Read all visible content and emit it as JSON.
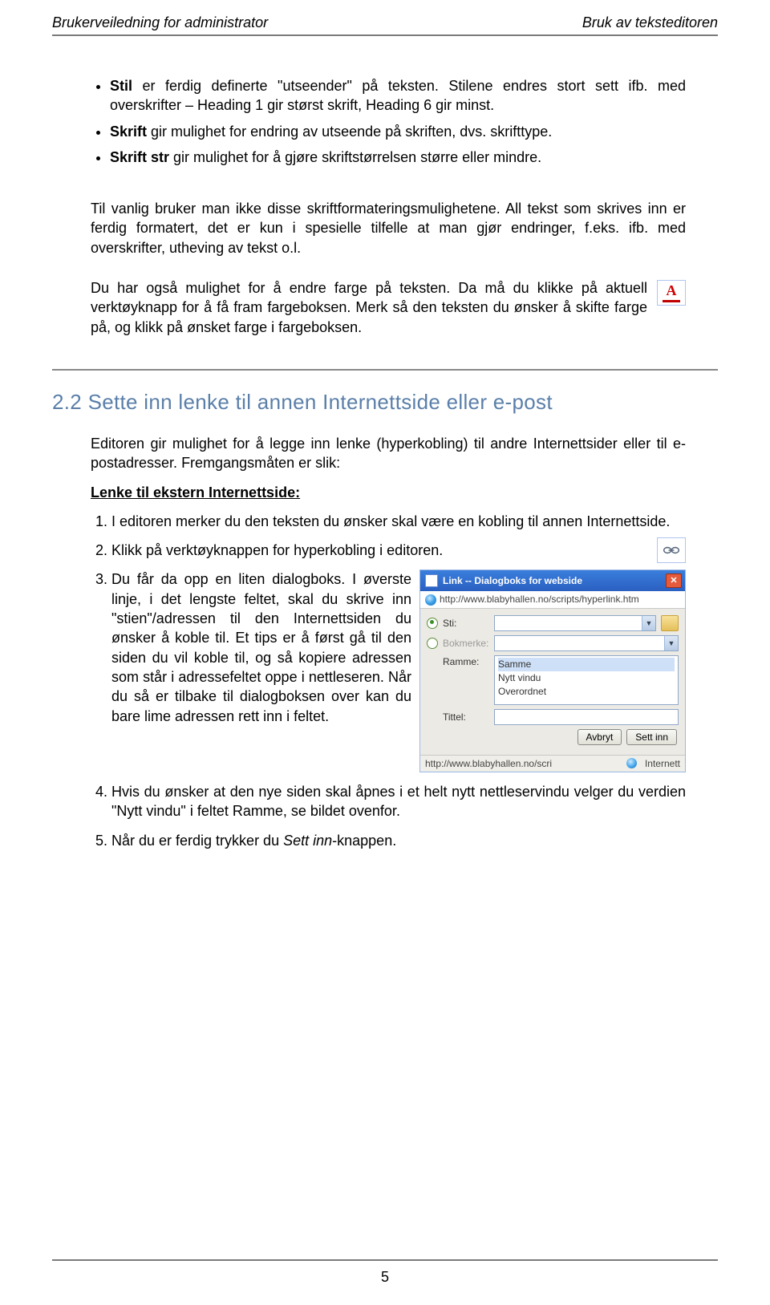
{
  "header": {
    "left": "Brukerveiledning for administrator",
    "right": "Bruk av teksteditoren"
  },
  "bullets": [
    {
      "label": "Stil",
      "text": " er ferdig definerte \"utseender\" på teksten. Stilene endres stort sett ifb. med overskrifter – Heading 1 gir størst skrift, Heading 6 gir minst."
    },
    {
      "label": "Skrift",
      "text": "  gir mulighet for endring av utseende på skriften, dvs. skrifttype."
    },
    {
      "label": "Skrift str",
      "text": " gir mulighet for å gjøre skriftstørrelsen større eller mindre."
    }
  ],
  "para1": "Til vanlig bruker man ikke disse skriftformateringsmulighetene. All tekst som skrives inn er ferdig formatert, det er kun i spesielle tilfelle at man gjør endringer, f.eks. ifb. med overskrifter, utheving av tekst o.l.",
  "para2": "Du har også mulighet for å endre farge på teksten. Da må du klikke på aktuell verktøyknapp for å få fram fargeboksen. Merk så den teksten du ønsker å skifte farge på, og klikk på ønsket farge i fargeboksen.",
  "section": {
    "num": "2.2",
    "title": "Sette inn lenke til annen Internettside eller e-post"
  },
  "intro": "Editoren gir mulighet for å legge inn lenke (hyperkobling) til andre Internettsider eller til e-postadresser. Fremgangsmåten er slik:",
  "subhead": "Lenke til ekstern Internettside:",
  "items": {
    "i1": "I editoren merker du den teksten du ønsker skal være en kobling til annen Internettside.",
    "i2": "Klikk på verktøyknappen for hyperkobling i editoren.",
    "i3": "Du får da opp en liten dialogboks. I øverste linje, i det lengste feltet, skal du skrive inn \"stien\"/adressen til den Internettsiden du ønsker å koble til. Et tips er å først gå til den siden du vil koble til, og så kopiere adressen som står i adressefeltet oppe i nettleseren. Når du så er tilbake til dialogboksen over kan du bare lime adressen rett inn i feltet.",
    "i4": "Hvis du ønsker at den nye siden skal åpnes i et helt nytt nettleservindu velger du verdien \"Nytt vindu\" i feltet Ramme, se bildet ovenfor.",
    "i5a": "Når du er ferdig trykker du ",
    "i5b": "Sett inn",
    "i5c": "-knappen."
  },
  "dialog": {
    "title": "Link -- Dialogboks for webside",
    "url": "http://www.blabyhallen.no/scripts/hyperlink.htm",
    "fields": {
      "sti": "Sti:",
      "bokmerke": "Bokmerke:",
      "ramme": "Ramme:",
      "tittel": "Tittel:"
    },
    "options": [
      "Samme",
      "Nytt vindu",
      "Overordnet"
    ],
    "buttons": {
      "cancel": "Avbryt",
      "ok": "Sett inn"
    },
    "status_url": "http://www.blabyhallen.no/scri",
    "status_zone": "Internett"
  },
  "icons": {
    "textcolor": "A"
  },
  "footer": {
    "page": "5"
  }
}
